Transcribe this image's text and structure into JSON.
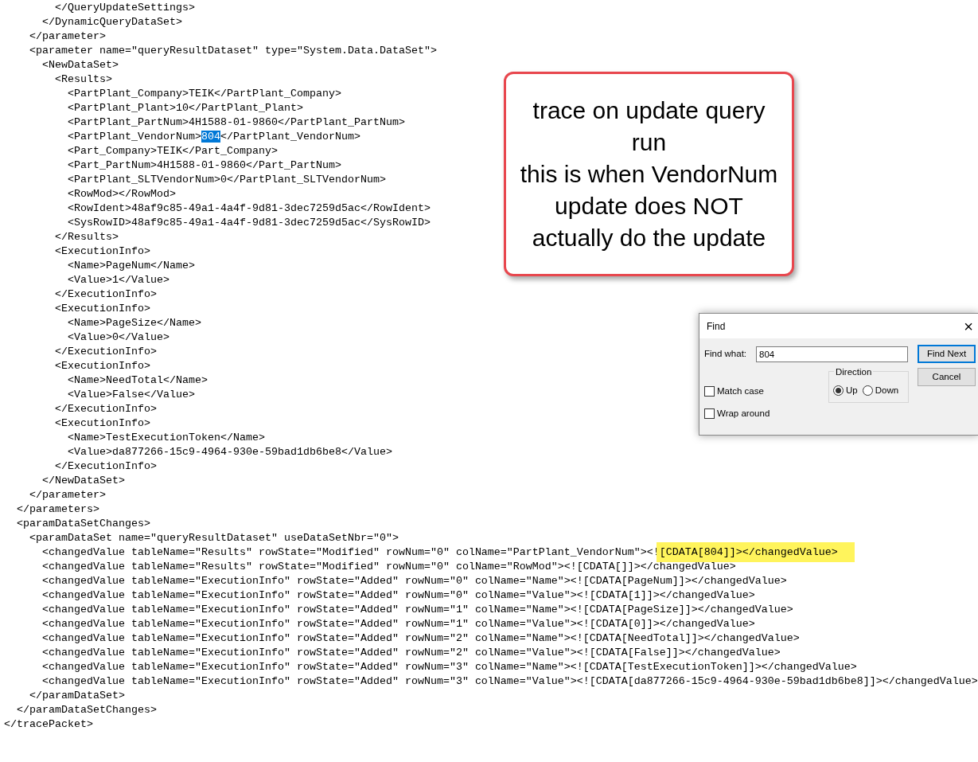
{
  "document": {
    "close": "</tracePacket>",
    "children": [
      {
        "close": "</parameters>",
        "children": [
          {
            "close": "</parameter>",
            "children": [
              {
                "close": "</DynamicQueryDataSet>",
                "children": [
                  {
                    "close": "</QueryUpdateSettings>"
                  }
                ]
              }
            ]
          },
          {
            "open": "<parameter name=\"queryResultDataset\" type=\"System.Data.DataSet\">",
            "close": "</parameter>",
            "children": [
              {
                "open": "<NewDataSet>",
                "close": "</NewDataSet>",
                "children": [
                  {
                    "open": "<Results>",
                    "close": "</Results>",
                    "children": [
                      {
                        "line": "<PartPlant_Company>TEIK</PartPlant_Company>"
                      },
                      {
                        "line": "<PartPlant_Plant>10</PartPlant_Plant>"
                      },
                      {
                        "line": "<PartPlant_PartNum>4H1588-01-9860</PartPlant_PartNum>"
                      },
                      {
                        "parts": [
                          {
                            "text": "<PartPlant_VendorNum>"
                          },
                          {
                            "text": "804",
                            "kind": "selection"
                          },
                          {
                            "text": "</PartPlant_VendorNum>"
                          }
                        ]
                      },
                      {
                        "line": "<Part_Company>TEIK</Part_Company>"
                      },
                      {
                        "line": "<Part_PartNum>4H1588-01-9860</Part_PartNum>"
                      },
                      {
                        "line": "<PartPlant_SLTVendorNum>0</PartPlant_SLTVendorNum>"
                      },
                      {
                        "line": "<RowMod></RowMod>"
                      },
                      {
                        "line": "<RowIdent>48af9c85-49a1-4a4f-9d81-3dec7259d5ac</RowIdent>"
                      },
                      {
                        "line": "<SysRowID>48af9c85-49a1-4a4f-9d81-3dec7259d5ac</SysRowID>"
                      }
                    ]
                  },
                  {
                    "open": "<ExecutionInfo>",
                    "close": "</ExecutionInfo>",
                    "children": [
                      {
                        "line": "<Name>PageNum</Name>"
                      },
                      {
                        "line": "<Value>1</Value>"
                      }
                    ]
                  },
                  {
                    "open": "<ExecutionInfo>",
                    "close": "</ExecutionInfo>",
                    "children": [
                      {
                        "line": "<Name>PageSize</Name>"
                      },
                      {
                        "line": "<Value>0</Value>"
                      }
                    ]
                  },
                  {
                    "open": "<ExecutionInfo>",
                    "close": "</ExecutionInfo>",
                    "children": [
                      {
                        "line": "<Name>NeedTotal</Name>"
                      },
                      {
                        "line": "<Value>False</Value>"
                      }
                    ]
                  },
                  {
                    "open": "<ExecutionInfo>",
                    "close": "</ExecutionInfo>",
                    "children": [
                      {
                        "line": "<Name>TestExecutionToken</Name>"
                      },
                      {
                        "line": "<Value>da877266-15c9-4964-930e-59bad1db6be8</Value>"
                      }
                    ]
                  }
                ]
              }
            ]
          }
        ]
      },
      {
        "open": "<paramDataSetChanges>",
        "close": "</paramDataSetChanges>",
        "children": [
          {
            "open": "<paramDataSet name=\"queryResultDataset\" useDataSetNbr=\"0\">",
            "close": "</paramDataSet>",
            "children": [
              {
                "parts": [
                  {
                    "text": "<changedValue tableName=\"Results\" rowState=\"Modified\" rowNum=\"0\" colName=\"PartPlant_VendorNum\"><!"
                  },
                  {
                    "text": "[CDATA[804]]></changedValue>",
                    "kind": "highlight"
                  }
                ]
              },
              {
                "line": "<changedValue tableName=\"Results\" rowState=\"Modified\" rowNum=\"0\" colName=\"RowMod\"><![CDATA[]]></changedValue>"
              },
              {
                "line": "<changedValue tableName=\"ExecutionInfo\" rowState=\"Added\" rowNum=\"0\" colName=\"Name\"><![CDATA[PageNum]]></changedValue>"
              },
              {
                "line": "<changedValue tableName=\"ExecutionInfo\" rowState=\"Added\" rowNum=\"0\" colName=\"Value\"><![CDATA[1]]></changedValue>"
              },
              {
                "line": "<changedValue tableName=\"ExecutionInfo\" rowState=\"Added\" rowNum=\"1\" colName=\"Name\"><![CDATA[PageSize]]></changedValue>"
              },
              {
                "line": "<changedValue tableName=\"ExecutionInfo\" rowState=\"Added\" rowNum=\"1\" colName=\"Value\"><![CDATA[0]]></changedValue>"
              },
              {
                "line": "<changedValue tableName=\"ExecutionInfo\" rowState=\"Added\" rowNum=\"2\" colName=\"Name\"><![CDATA[NeedTotal]]></changedValue>"
              },
              {
                "line": "<changedValue tableName=\"ExecutionInfo\" rowState=\"Added\" rowNum=\"2\" colName=\"Value\"><![CDATA[False]]></changedValue>"
              },
              {
                "line": "<changedValue tableName=\"ExecutionInfo\" rowState=\"Added\" rowNum=\"3\" colName=\"Name\"><![CDATA[TestExecutionToken]]></changedValue>"
              },
              {
                "line": "<changedValue tableName=\"ExecutionInfo\" rowState=\"Added\" rowNum=\"3\" colName=\"Value\"><![CDATA[da877266-15c9-4964-930e-59bad1db6be8]]></changedValue>"
              }
            ]
          }
        ]
      }
    ]
  },
  "callout": {
    "paragraphs": [
      "trace on update query run",
      "this is when VendorNum update does NOT actually do the update"
    ]
  },
  "find_dialog": {
    "title": "Find",
    "close": "×",
    "find_what": {
      "label": "Find what:",
      "value": "804"
    },
    "buttons": [
      {
        "label": "Find Next",
        "default": true
      },
      {
        "label": "Cancel",
        "default": false
      }
    ],
    "direction": {
      "label": "Direction",
      "options": [
        {
          "label": "Up",
          "selected": true
        },
        {
          "label": "Down",
          "selected": false
        }
      ]
    },
    "checkboxes": [
      {
        "label": "Match case",
        "checked": false
      },
      {
        "label": "Wrap around",
        "checked": false
      }
    ]
  }
}
